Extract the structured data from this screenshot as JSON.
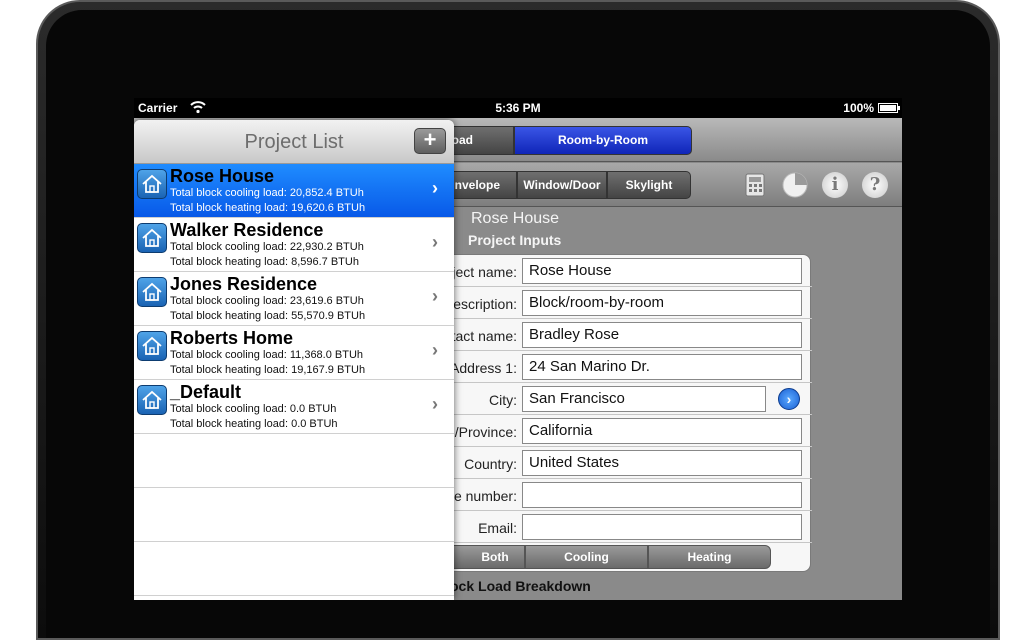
{
  "status_bar": {
    "carrier": "Carrier",
    "time": "5:36 PM",
    "battery": "100%"
  },
  "toolbar": {
    "segment_load_label": "oad",
    "segment_room_label": "Room-by-Room",
    "selected_segment": "Room-by-Room",
    "accent_color": "#1a36d6"
  },
  "sub_toolbar": {
    "envelope_label": "nvelope",
    "window_door_label": "Window/Door",
    "skylight_label": "Skylight",
    "icons": [
      "calculator-icon",
      "pie-chart-icon",
      "info-icon",
      "help-icon"
    ],
    "info_glyph": "i",
    "help_glyph": "?"
  },
  "main": {
    "project_title": "Rose House",
    "section_title": "Project Inputs",
    "fields": [
      {
        "label": "ject name:",
        "value": "Rose House"
      },
      {
        "label": "escription:",
        "value": "Block/room-by-room"
      },
      {
        "label": "tact name:",
        "value": "Bradley Rose"
      },
      {
        "label": "Address 1:",
        "value": "24 San Marino Dr."
      },
      {
        "label": "City:",
        "value": "San Francisco"
      },
      {
        "label": "/Province:",
        "value": "California"
      },
      {
        "label": "Country:",
        "value": "United States"
      },
      {
        "label": "e number:",
        "value": ""
      },
      {
        "label": "Email:",
        "value": ""
      }
    ],
    "load_segments": {
      "both": "Both",
      "cooling": "Cooling",
      "heating": "Heating"
    },
    "breakdown_title": "ock Load Breakdown"
  },
  "project_list": {
    "title": "Project List",
    "add_label": "+",
    "selected_color": "#0f6df2",
    "projects": [
      {
        "name": "Rose House",
        "cooling": "Total block cooling load: 20,852.4 BTUh",
        "heating": "Total block heating load: 19,620.6 BTUh",
        "selected": true
      },
      {
        "name": "Walker Residence",
        "cooling": "Total block cooling load: 22,930.2 BTUh",
        "heating": "Total block heating load: 8,596.7 BTUh",
        "selected": false
      },
      {
        "name": "Jones Residence",
        "cooling": "Total block cooling load: 23,619.6 BTUh",
        "heating": "Total block heating load: 55,570.9 BTUh",
        "selected": false
      },
      {
        "name": "Roberts Home",
        "cooling": "Total block cooling load: 11,368.0 BTUh",
        "heating": "Total block heating load: 19,167.9 BTUh",
        "selected": false
      },
      {
        "name": "_Default",
        "cooling": "Total block cooling load: 0.0 BTUh",
        "heating": "Total block heating load: 0.0 BTUh",
        "selected": false
      }
    ],
    "chevron": "›"
  }
}
